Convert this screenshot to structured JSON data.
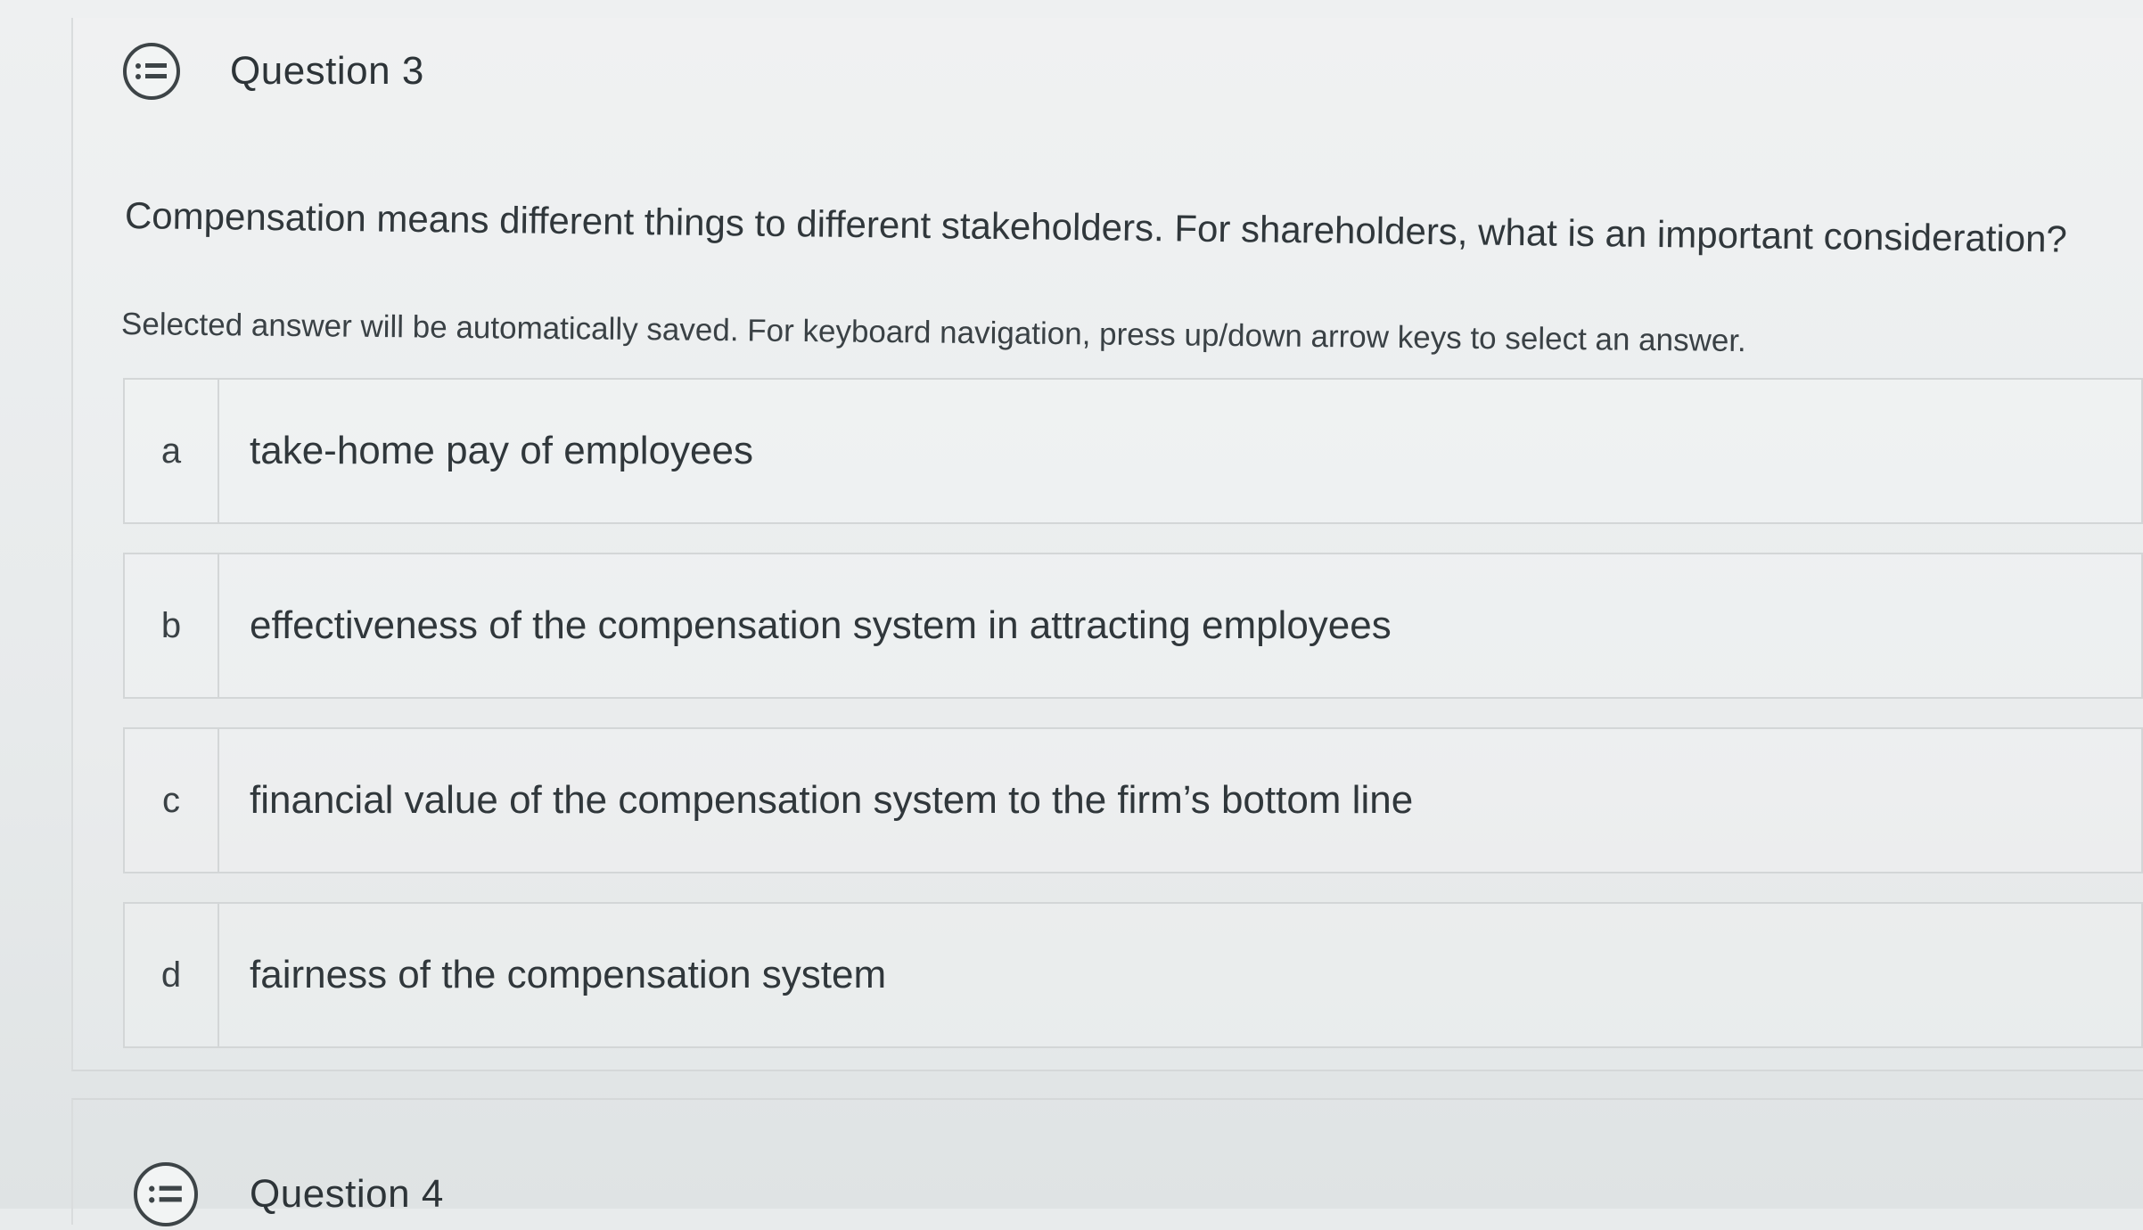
{
  "question3": {
    "title": "Question 3",
    "icon": "question-list-icon",
    "text": "Compensation means different things to different stakeholders. For shareholders, what is an important consideration?",
    "instructions": "Selected answer will be automatically saved. For keyboard navigation, press up/down arrow keys to select an answer.",
    "answers": [
      {
        "letter": "a",
        "text": "take-home pay of employees"
      },
      {
        "letter": "b",
        "text": "effectiveness of the compensation system in attracting employees"
      },
      {
        "letter": "c",
        "text": "financial value of the compensation system to the firm’s bottom line"
      },
      {
        "letter": "d",
        "text": "fairness of the compensation system"
      }
    ]
  },
  "question4": {
    "title": "Question 4",
    "icon": "question-list-icon"
  },
  "colors": {
    "background": "#e8ebec",
    "text": "#30373b",
    "border": "#d3d6d7",
    "icon": "#3d4447"
  }
}
